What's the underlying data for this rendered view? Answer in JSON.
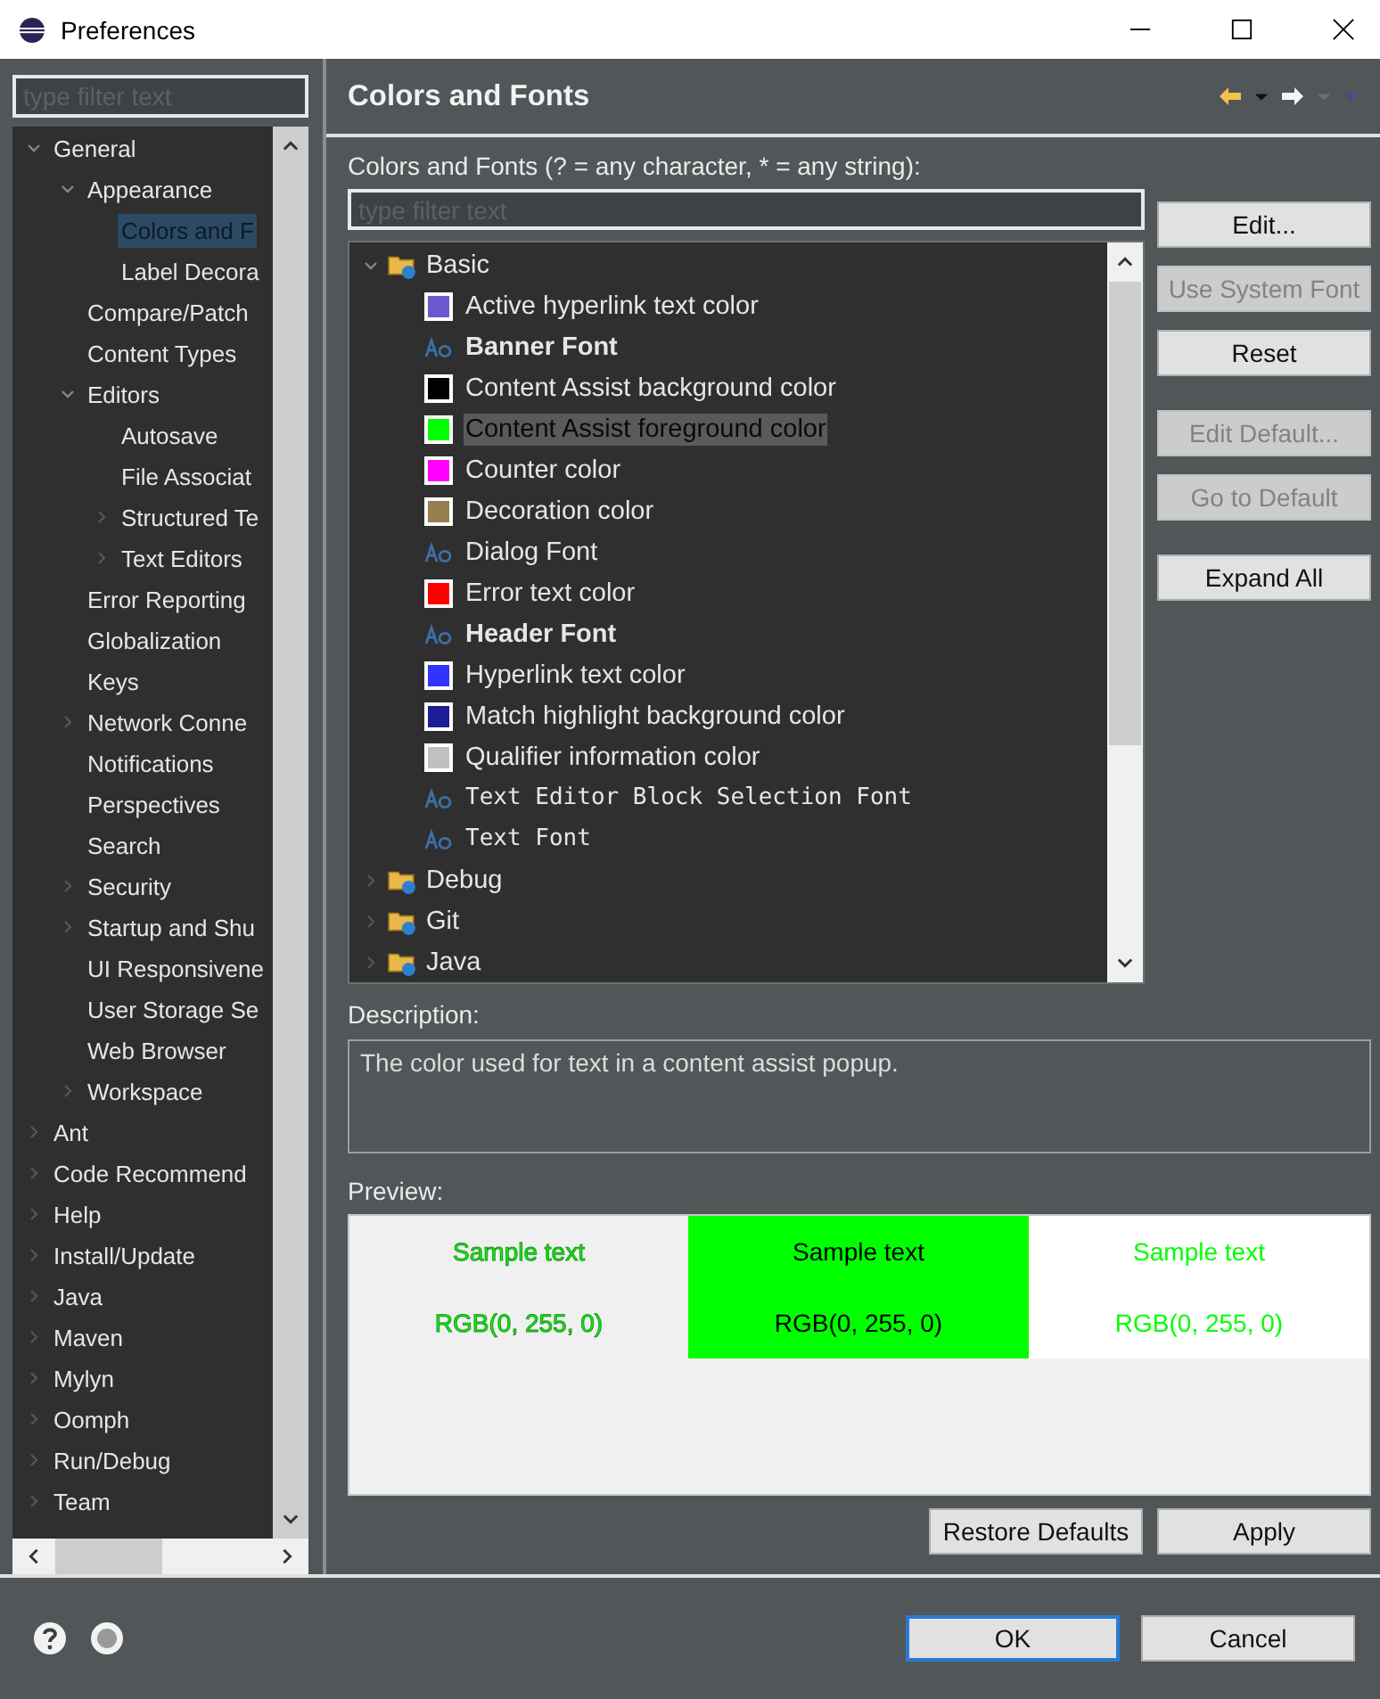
{
  "window": {
    "title": "Preferences"
  },
  "sidebar": {
    "filter": {
      "placeholder": "type filter text"
    },
    "tree": [
      {
        "label": "General",
        "expanded": true,
        "selected": false,
        "children": [
          {
            "label": "Appearance",
            "expanded": true,
            "selected": false,
            "children": [
              {
                "label": "Colors and F",
                "selected": true
              },
              {
                "label": "Label Decora",
                "selected": false
              }
            ]
          },
          {
            "label": "Compare/Patch",
            "selected": false
          },
          {
            "label": "Content Types",
            "selected": false
          },
          {
            "label": "Editors",
            "expanded": true,
            "selected": false,
            "children": [
              {
                "label": "Autosave",
                "selected": false
              },
              {
                "label": "File Associat",
                "selected": false
              },
              {
                "label": "Structured Te",
                "expanded": false,
                "selected": false
              },
              {
                "label": "Text Editors",
                "expanded": false,
                "selected": false
              }
            ]
          },
          {
            "label": "Error Reporting",
            "selected": false
          },
          {
            "label": "Globalization",
            "selected": false
          },
          {
            "label": "Keys",
            "selected": false
          },
          {
            "label": "Network Conne",
            "expanded": false,
            "selected": false
          },
          {
            "label": "Notifications",
            "selected": false
          },
          {
            "label": "Perspectives",
            "selected": false
          },
          {
            "label": "Search",
            "selected": false
          },
          {
            "label": "Security",
            "expanded": false,
            "selected": false
          },
          {
            "label": "Startup and Shu",
            "expanded": false,
            "selected": false
          },
          {
            "label": "UI Responsivene",
            "selected": false
          },
          {
            "label": "User Storage Se",
            "selected": false
          },
          {
            "label": "Web Browser",
            "selected": false
          },
          {
            "label": "Workspace",
            "expanded": false,
            "selected": false
          }
        ]
      },
      {
        "label": "Ant",
        "expanded": false,
        "selected": false
      },
      {
        "label": "Code Recommend",
        "expanded": false,
        "selected": false
      },
      {
        "label": "Help",
        "expanded": false,
        "selected": false
      },
      {
        "label": "Install/Update",
        "expanded": false,
        "selected": false
      },
      {
        "label": "Java",
        "expanded": false,
        "selected": false
      },
      {
        "label": "Maven",
        "expanded": false,
        "selected": false
      },
      {
        "label": "Mylyn",
        "expanded": false,
        "selected": false
      },
      {
        "label": "Oomph",
        "expanded": false,
        "selected": false
      },
      {
        "label": "Run/Debug",
        "expanded": false,
        "selected": false
      },
      {
        "label": "Team",
        "expanded": false,
        "selected": false
      }
    ]
  },
  "page": {
    "title": "Colors and Fonts",
    "filter_label": "Colors and Fonts (? = any character, * = any string):",
    "filter": {
      "placeholder": "type filter text"
    },
    "categories": [
      {
        "label": "Basic",
        "expanded": true,
        "items": [
          {
            "kind": "color",
            "label": "Active hyperlink text color",
            "color": "#6a5acd",
            "selected": false
          },
          {
            "kind": "boldfont",
            "label": "Banner Font",
            "selected": false
          },
          {
            "kind": "color",
            "label": "Content Assist background color",
            "color": "#000000",
            "selected": false
          },
          {
            "kind": "color",
            "label": "Content Assist foreground color",
            "color": "#00ff00",
            "selected": true
          },
          {
            "kind": "color",
            "label": "Counter color",
            "color": "#ff00ff",
            "selected": false
          },
          {
            "kind": "color",
            "label": "Decoration color",
            "color": "#957f4f",
            "selected": false
          },
          {
            "kind": "font",
            "label": "Dialog Font",
            "selected": false
          },
          {
            "kind": "color",
            "label": "Error text color",
            "color": "#ff0000",
            "selected": false
          },
          {
            "kind": "boldfont",
            "label": "Header Font",
            "selected": false
          },
          {
            "kind": "color",
            "label": "Hyperlink text color",
            "color": "#3333ff",
            "selected": false
          },
          {
            "kind": "color",
            "label": "Match highlight background color",
            "color": "#1c1c96",
            "selected": false
          },
          {
            "kind": "color",
            "label": "Qualifier information color",
            "color": "#c0c0c0",
            "selected": false
          },
          {
            "kind": "monofont",
            "label": "Text Editor Block Selection Font",
            "selected": false
          },
          {
            "kind": "monofont",
            "label": "Text Font",
            "selected": false
          }
        ]
      },
      {
        "label": "Debug",
        "expanded": false
      },
      {
        "label": "Git",
        "expanded": false
      },
      {
        "label": "Java",
        "expanded": false
      }
    ],
    "side_buttons": [
      {
        "label": "Edit...",
        "disabled": false
      },
      {
        "label": "Use System Font",
        "disabled": true
      },
      {
        "label": "Reset",
        "disabled": false
      },
      {
        "label": "Edit Default...",
        "disabled": true
      },
      {
        "label": "Go to Default",
        "disabled": true
      },
      {
        "label": "Expand All",
        "disabled": false
      }
    ],
    "description_label": "Description:",
    "description": "The color used for text in a content assist popup.",
    "preview_label": "Preview:",
    "preview": [
      {
        "kind": "system",
        "color": "#00ff00",
        "text": "Sample text",
        "rgb": "RGB(0, 255, 0)"
      },
      {
        "kind": "swatch",
        "color": "#00ff00",
        "text": "Sample text",
        "rgb": "RGB(0, 255, 0)"
      },
      {
        "kind": "white",
        "color": "#00ff00",
        "text": "Sample text",
        "rgb": "RGB(0, 255, 0)"
      }
    ],
    "buttons": [
      "Restore Defaults",
      "Apply"
    ]
  },
  "footer": {
    "buttons": [
      {
        "label": "OK",
        "default": true
      },
      {
        "label": "Cancel",
        "default": false
      }
    ]
  }
}
